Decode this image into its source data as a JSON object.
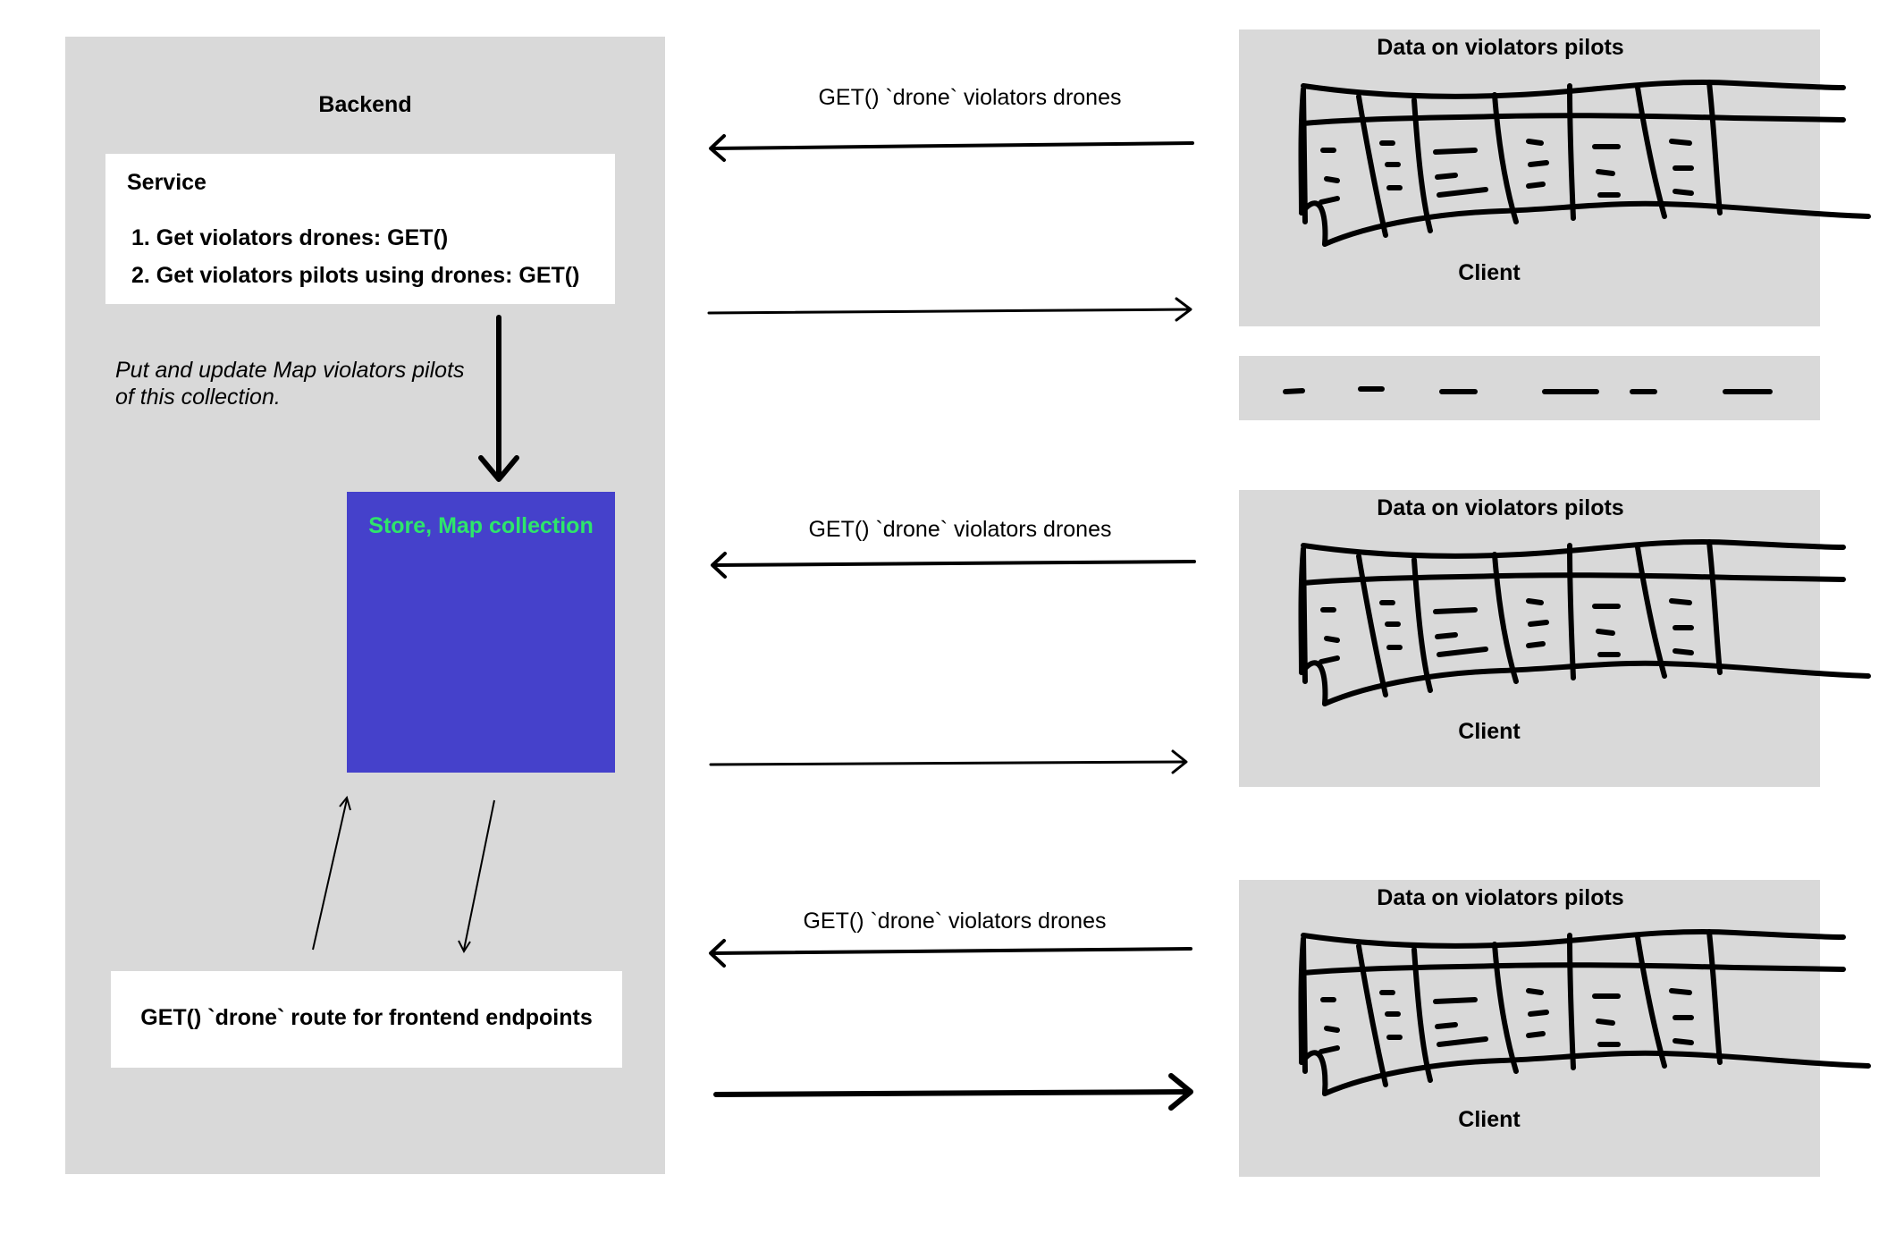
{
  "backend": {
    "title": "Backend",
    "service": {
      "title": "Service",
      "steps": [
        "1. Get violators drones: GET()",
        "2. Get violators pilots using drones: GET()"
      ]
    },
    "note_lines": [
      "Put and update Map violators pilots",
      "of this collection."
    ],
    "store_label": "Store, Map collection",
    "route_label": "GET() `drone` route for frontend endpoints"
  },
  "flows": [
    {
      "request_label": "GET() `drone` violators drones"
    },
    {
      "request_label": "GET() `drone` violators drones"
    },
    {
      "request_label": "GET() `drone` violators drones"
    }
  ],
  "clients": [
    {
      "header": "Data on violators pilots",
      "footer": "Client"
    },
    {
      "header": "Data on violators pilots",
      "footer": "Client"
    },
    {
      "header": "Data on violators pilots",
      "footer": "Client"
    }
  ],
  "colors": {
    "panel": "#d9d9d9",
    "store_fill": "#4541cb",
    "store_text": "#2ee56b"
  }
}
